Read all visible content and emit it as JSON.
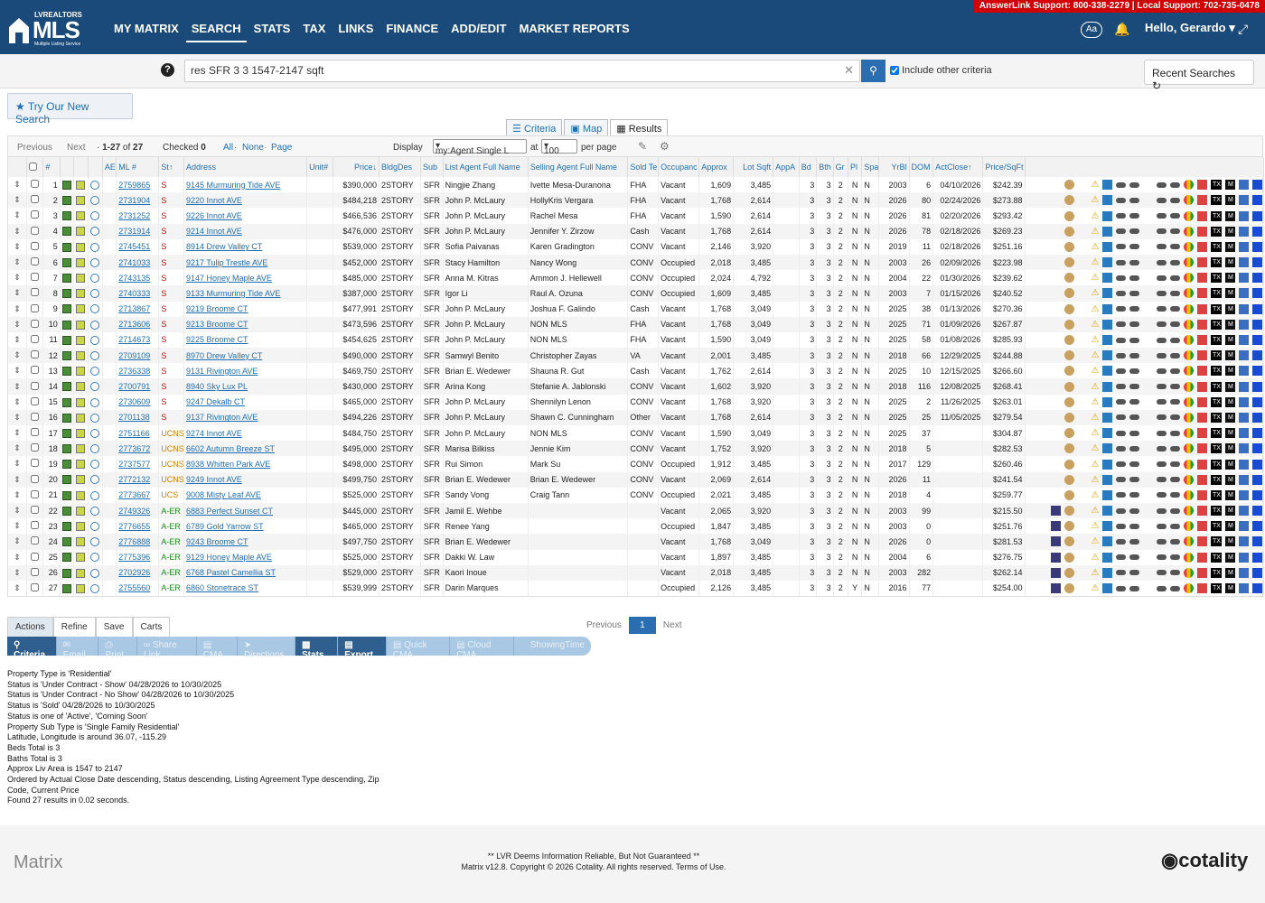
{
  "support": {
    "text": "AnswerLink Support: 800-338-2279 | Local Support: 702-735-0478"
  },
  "logo": {
    "top": "LVREALTORS",
    "main": "MLS",
    "sub": "Multiple Listing Service"
  },
  "nav": [
    "MY MATRIX",
    "SEARCH",
    "STATS",
    "TAX",
    "LINKS",
    "FINANCE",
    "ADD/EDIT",
    "MARKET REPORTS"
  ],
  "header": {
    "aa": "Aa",
    "hello": "Hello, Gerardo"
  },
  "search": {
    "value": "res SFR 3 3 1547-2147 sqft",
    "include": "Include other criteria",
    "recent": "Recent Searches"
  },
  "try_new": "Try Our New Search",
  "view_tabs": [
    "Criteria",
    "Map",
    "Results"
  ],
  "pagebar": {
    "previous": "Previous",
    "next": "Next",
    "range": "1-27",
    "of": "of",
    "total": "27",
    "checked_label": "Checked",
    "checked": "0",
    "all": "All",
    "none": "None",
    "page": "Page",
    "display": "Display",
    "display_value": "my:Agent Single L",
    "at": "at",
    "per_value": "100",
    "per_page": "per page"
  },
  "columns": [
    "",
    "#",
    "",
    "",
    "",
    "AE",
    "ML #",
    "St",
    "Address",
    "Unit#",
    "Price",
    "BldgDes",
    "Sub",
    "List Agent Full Name",
    "Selling Agent Full Name",
    "Sold Te",
    "Occupanc",
    "Approx",
    "Lot Sqft",
    "AppA",
    "Bd",
    "Bth",
    "Gr",
    "Pl",
    "Spa",
    "YrBl",
    "DOM",
    "ActClose",
    "Price/SqFt"
  ],
  "rows": [
    {
      "n": "1",
      "ml": "2759865",
      "st": "S",
      "addr": "9145 Murmuring Tide AVE",
      "price": "$390,000",
      "bldg": "2STORY",
      "sub": "SFR",
      "list": "Ningjie Zhang",
      "sell": "Ivette Mesa-Duranona",
      "terms": "FHA",
      "occ": "Vacant",
      "approx": "1,609",
      "lot": "3,485",
      "bd": "3",
      "bth": "3",
      "gr": "2",
      "pl": "N",
      "spa": "N",
      "yr": "2003",
      "dom": "6",
      "close": "04/10/2026",
      "ppsf": "$242.39"
    },
    {
      "n": "2",
      "ml": "2731904",
      "st": "S",
      "addr": "9220 Innot AVE",
      "price": "$484,218",
      "bldg": "2STORY",
      "sub": "SFR",
      "list": "John P. McLaury",
      "sell": "HollyKris Vergara",
      "terms": "FHA",
      "occ": "Vacant",
      "approx": "1,768",
      "lot": "2,614",
      "bd": "3",
      "bth": "3",
      "gr": "2",
      "pl": "N",
      "spa": "N",
      "yr": "2026",
      "dom": "80",
      "close": "02/24/2026",
      "ppsf": "$273.88"
    },
    {
      "n": "3",
      "ml": "2731252",
      "st": "S",
      "addr": "9226 Innot AVE",
      "price": "$466,536",
      "bldg": "2STORY",
      "sub": "SFR",
      "list": "John P. McLaury",
      "sell": "Rachel Mesa",
      "terms": "FHA",
      "occ": "Vacant",
      "approx": "1,590",
      "lot": "2,614",
      "bd": "3",
      "bth": "3",
      "gr": "2",
      "pl": "N",
      "spa": "N",
      "yr": "2026",
      "dom": "81",
      "close": "02/20/2026",
      "ppsf": "$293.42"
    },
    {
      "n": "4",
      "ml": "2731914",
      "st": "S",
      "addr": "9214 Innot AVE",
      "price": "$476,000",
      "bldg": "2STORY",
      "sub": "SFR",
      "list": "John P. McLaury",
      "sell": "Jennifer Y. Zirzow",
      "terms": "Cash",
      "occ": "Vacant",
      "approx": "1,768",
      "lot": "2,614",
      "bd": "3",
      "bth": "3",
      "gr": "2",
      "pl": "N",
      "spa": "N",
      "yr": "2026",
      "dom": "78",
      "close": "02/18/2026",
      "ppsf": "$269.23"
    },
    {
      "n": "5",
      "ml": "2745451",
      "st": "S",
      "addr": "8914 Drew Valley CT",
      "price": "$539,000",
      "bldg": "2STORY",
      "sub": "SFR",
      "list": "Sofia Paivanas",
      "sell": "Karen Gradington",
      "terms": "CONV",
      "occ": "Vacant",
      "approx": "2,146",
      "lot": "3,920",
      "bd": "3",
      "bth": "3",
      "gr": "2",
      "pl": "N",
      "spa": "N",
      "yr": "2019",
      "dom": "11",
      "close": "02/18/2026",
      "ppsf": "$251.16"
    },
    {
      "n": "6",
      "ml": "2741033",
      "st": "S",
      "addr": "9217 Tulip Trestle AVE",
      "price": "$452,000",
      "bldg": "2STORY",
      "sub": "SFR",
      "list": "Stacy Hamilton",
      "sell": "Nancy Wong",
      "terms": "CONV",
      "occ": "Occupied",
      "approx": "2,018",
      "lot": "3,485",
      "bd": "3",
      "bth": "3",
      "gr": "2",
      "pl": "N",
      "spa": "N",
      "yr": "2003",
      "dom": "26",
      "close": "02/09/2026",
      "ppsf": "$223.98"
    },
    {
      "n": "7",
      "ml": "2743135",
      "st": "S",
      "addr": "9147 Honey Maple AVE",
      "price": "$485,000",
      "bldg": "2STORY",
      "sub": "SFR",
      "list": "Anna M. Kitras",
      "sell": "Ammon J. Hellewell",
      "terms": "CONV",
      "occ": "Occupied",
      "approx": "2,024",
      "lot": "4,792",
      "bd": "3",
      "bth": "3",
      "gr": "2",
      "pl": "N",
      "spa": "N",
      "yr": "2004",
      "dom": "22",
      "close": "01/30/2026",
      "ppsf": "$239.62"
    },
    {
      "n": "8",
      "ml": "2740333",
      "st": "S",
      "addr": "9133 Murmuring Tide AVE",
      "price": "$387,000",
      "bldg": "2STORY",
      "sub": "SFR",
      "list": "Igor Li",
      "sell": "Raul A. Ozuna",
      "terms": "CONV",
      "occ": "Occupied",
      "approx": "1,609",
      "lot": "3,485",
      "bd": "3",
      "bth": "3",
      "gr": "2",
      "pl": "N",
      "spa": "N",
      "yr": "2003",
      "dom": "7",
      "close": "01/15/2026",
      "ppsf": "$240.52"
    },
    {
      "n": "9",
      "ml": "2713867",
      "st": "S",
      "addr": "9219 Broome CT",
      "price": "$477,991",
      "bldg": "2STORY",
      "sub": "SFR",
      "list": "John P. McLaury",
      "sell": "Joshua F. Galindo",
      "terms": "Cash",
      "occ": "Vacant",
      "approx": "1,768",
      "lot": "3,049",
      "bd": "3",
      "bth": "3",
      "gr": "2",
      "pl": "N",
      "spa": "N",
      "yr": "2025",
      "dom": "38",
      "close": "01/13/2026",
      "ppsf": "$270.36"
    },
    {
      "n": "10",
      "ml": "2713606",
      "st": "S",
      "addr": "9213 Broome CT",
      "price": "$473,596",
      "bldg": "2STORY",
      "sub": "SFR",
      "list": "John P. McLaury",
      "sell": "NON MLS",
      "terms": "FHA",
      "occ": "Vacant",
      "approx": "1,768",
      "lot": "3,049",
      "bd": "3",
      "bth": "3",
      "gr": "2",
      "pl": "N",
      "spa": "N",
      "yr": "2025",
      "dom": "71",
      "close": "01/09/2026",
      "ppsf": "$267.87"
    },
    {
      "n": "11",
      "ml": "2714673",
      "st": "S",
      "addr": "9225 Broome CT",
      "price": "$454,625",
      "bldg": "2STORY",
      "sub": "SFR",
      "list": "John P. McLaury",
      "sell": "NON MLS",
      "terms": "FHA",
      "occ": "Vacant",
      "approx": "1,590",
      "lot": "3,049",
      "bd": "3",
      "bth": "3",
      "gr": "2",
      "pl": "N",
      "spa": "N",
      "yr": "2025",
      "dom": "58",
      "close": "01/08/2026",
      "ppsf": "$285.93"
    },
    {
      "n": "12",
      "ml": "2709109",
      "st": "S",
      "addr": "8970 Drew Valley CT",
      "price": "$490,000",
      "bldg": "2STORY",
      "sub": "SFR",
      "list": "Samwyl Benito",
      "sell": "Christopher Zayas",
      "terms": "VA",
      "occ": "Vacant",
      "approx": "2,001",
      "lot": "3,485",
      "bd": "3",
      "bth": "3",
      "gr": "2",
      "pl": "N",
      "spa": "N",
      "yr": "2018",
      "dom": "66",
      "close": "12/29/2025",
      "ppsf": "$244.88"
    },
    {
      "n": "13",
      "ml": "2736338",
      "st": "S",
      "addr": "9131 Rivington AVE",
      "price": "$469,750",
      "bldg": "2STORY",
      "sub": "SFR",
      "list": "Brian E. Wedewer",
      "sell": "Shauna R. Gut",
      "terms": "Cash",
      "occ": "Vacant",
      "approx": "1,762",
      "lot": "2,614",
      "bd": "3",
      "bth": "3",
      "gr": "2",
      "pl": "N",
      "spa": "N",
      "yr": "2025",
      "dom": "10",
      "close": "12/15/2025",
      "ppsf": "$266.60"
    },
    {
      "n": "14",
      "ml": "2700791",
      "st": "S",
      "addr": "8940 Sky Lux PL",
      "price": "$430,000",
      "bldg": "2STORY",
      "sub": "SFR",
      "list": "Arina Kong",
      "sell": "Stefanie A. Jablonski",
      "terms": "CONV",
      "occ": "Vacant",
      "approx": "1,602",
      "lot": "3,920",
      "bd": "3",
      "bth": "3",
      "gr": "2",
      "pl": "N",
      "spa": "N",
      "yr": "2018",
      "dom": "116",
      "close": "12/08/2025",
      "ppsf": "$268.41"
    },
    {
      "n": "15",
      "ml": "2730609",
      "st": "S",
      "addr": "9247 Dekalb CT",
      "price": "$465,000",
      "bldg": "2STORY",
      "sub": "SFR",
      "list": "John P. McLaury",
      "sell": "Shennilyn Lenon",
      "terms": "CONV",
      "occ": "Vacant",
      "approx": "1,768",
      "lot": "3,920",
      "bd": "3",
      "bth": "3",
      "gr": "2",
      "pl": "N",
      "spa": "N",
      "yr": "2025",
      "dom": "2",
      "close": "11/26/2025",
      "ppsf": "$263.01"
    },
    {
      "n": "16",
      "ml": "2701138",
      "st": "S",
      "addr": "9137 Rivington AVE",
      "price": "$494,226",
      "bldg": "2STORY",
      "sub": "SFR",
      "list": "John P. McLaury",
      "sell": "Shawn C. Cunningham",
      "terms": "Other",
      "occ": "Vacant",
      "approx": "1,768",
      "lot": "2,614",
      "bd": "3",
      "bth": "3",
      "gr": "2",
      "pl": "N",
      "spa": "N",
      "yr": "2025",
      "dom": "25",
      "close": "11/05/2025",
      "ppsf": "$279.54"
    },
    {
      "n": "17",
      "ml": "2751166",
      "st": "UCNS",
      "addr": "9274 Innot AVE",
      "price": "$484,750",
      "bldg": "2STORY",
      "sub": "SFR",
      "list": "John P. McLaury",
      "sell": "NON MLS",
      "terms": "CONV",
      "occ": "Vacant",
      "approx": "1,590",
      "lot": "3,049",
      "bd": "3",
      "bth": "3",
      "gr": "2",
      "pl": "N",
      "spa": "N",
      "yr": "2025",
      "dom": "37",
      "close": "",
      "ppsf": "$304.87"
    },
    {
      "n": "18",
      "ml": "2773672",
      "st": "UCNS",
      "addr": "6602 Autumn Breeze ST",
      "price": "$495,000",
      "bldg": "2STORY",
      "sub": "SFR",
      "list": "Marisa Bilkiss",
      "sell": "Jennie Kim",
      "terms": "CONV",
      "occ": "Vacant",
      "approx": "1,752",
      "lot": "3,920",
      "bd": "3",
      "bth": "3",
      "gr": "2",
      "pl": "N",
      "spa": "N",
      "yr": "2018",
      "dom": "5",
      "close": "",
      "ppsf": "$282.53"
    },
    {
      "n": "19",
      "ml": "2737577",
      "st": "UCNS",
      "addr": "8938 Whitten Park AVE",
      "price": "$498,000",
      "bldg": "2STORY",
      "sub": "SFR",
      "list": "Rui Simon",
      "sell": "Mark Su",
      "terms": "CONV",
      "occ": "Occupied",
      "approx": "1,912",
      "lot": "3,485",
      "bd": "3",
      "bth": "3",
      "gr": "2",
      "pl": "N",
      "spa": "N",
      "yr": "2017",
      "dom": "129",
      "close": "",
      "ppsf": "$260.46"
    },
    {
      "n": "20",
      "ml": "2772132",
      "st": "UCNS",
      "addr": "9249 Innot AVE",
      "price": "$499,750",
      "bldg": "2STORY",
      "sub": "SFR",
      "list": "Brian E. Wedewer",
      "sell": "Brian E. Wedewer",
      "terms": "CONV",
      "occ": "Vacant",
      "approx": "2,069",
      "lot": "2,614",
      "bd": "3",
      "bth": "3",
      "gr": "2",
      "pl": "N",
      "spa": "N",
      "yr": "2026",
      "dom": "11",
      "close": "",
      "ppsf": "$241.54"
    },
    {
      "n": "21",
      "ml": "2773667",
      "st": "UCS",
      "addr": "9008 Misty Leaf AVE",
      "price": "$525,000",
      "bldg": "2STORY",
      "sub": "SFR",
      "list": "Sandy Vong",
      "sell": "Craig Tann",
      "terms": "CONV",
      "occ": "Occupied",
      "approx": "2,021",
      "lot": "3,485",
      "bd": "3",
      "bth": "3",
      "gr": "2",
      "pl": "N",
      "spa": "N",
      "yr": "2018",
      "dom": "4",
      "close": "",
      "ppsf": "$259.77"
    },
    {
      "n": "22",
      "ml": "2749326",
      "st": "A-ER",
      "addr": "6883 Perfect Sunset CT",
      "price": "$445,000",
      "bldg": "2STORY",
      "sub": "SFR",
      "list": "Jamil E. Wehbe",
      "sell": "",
      "terms": "",
      "occ": "Vacant",
      "approx": "2,065",
      "lot": "3,920",
      "bd": "3",
      "bth": "3",
      "gr": "2",
      "pl": "N",
      "spa": "N",
      "yr": "2003",
      "dom": "99",
      "close": "",
      "ppsf": "$215.50"
    },
    {
      "n": "23",
      "ml": "2776655",
      "st": "A-ER",
      "addr": "6789 Gold Yarrow ST",
      "price": "$465,000",
      "bldg": "2STORY",
      "sub": "SFR",
      "list": "Renee Yang",
      "sell": "",
      "terms": "",
      "occ": "Occupied",
      "approx": "1,847",
      "lot": "3,485",
      "bd": "3",
      "bth": "3",
      "gr": "2",
      "pl": "N",
      "spa": "N",
      "yr": "2003",
      "dom": "0",
      "close": "",
      "ppsf": "$251.76"
    },
    {
      "n": "24",
      "ml": "2776888",
      "st": "A-ER",
      "addr": "9243 Broome CT",
      "price": "$497,750",
      "bldg": "2STORY",
      "sub": "SFR",
      "list": "Brian E. Wedewer",
      "sell": "",
      "terms": "",
      "occ": "Vacant",
      "approx": "1,768",
      "lot": "3,049",
      "bd": "3",
      "bth": "3",
      "gr": "2",
      "pl": "N",
      "spa": "N",
      "yr": "2026",
      "dom": "0",
      "close": "",
      "ppsf": "$281.53"
    },
    {
      "n": "25",
      "ml": "2775396",
      "st": "A-ER",
      "addr": "9129 Honey Maple AVE",
      "price": "$525,000",
      "bldg": "2STORY",
      "sub": "SFR",
      "list": "Dakki W. Law",
      "sell": "",
      "terms": "",
      "occ": "Vacant",
      "approx": "1,897",
      "lot": "3,485",
      "bd": "3",
      "bth": "3",
      "gr": "2",
      "pl": "N",
      "spa": "N",
      "yr": "2004",
      "dom": "6",
      "close": "",
      "ppsf": "$276.75"
    },
    {
      "n": "26",
      "ml": "2702926",
      "st": "A-ER",
      "addr": "6768 Pastel Camellia ST",
      "price": "$529,000",
      "bldg": "2STORY",
      "sub": "SFR",
      "list": "Kaori Inoue",
      "sell": "",
      "terms": "",
      "occ": "Vacant",
      "approx": "2,018",
      "lot": "3,485",
      "bd": "3",
      "bth": "3",
      "gr": "2",
      "pl": "N",
      "spa": "N",
      "yr": "2003",
      "dom": "282",
      "close": "",
      "ppsf": "$262.14"
    },
    {
      "n": "27",
      "ml": "2755560",
      "st": "A-ER",
      "addr": "6860 Stonetrace ST",
      "price": "$539,999",
      "bldg": "2STORY",
      "sub": "SFR",
      "list": "Darin Marques",
      "sell": "",
      "terms": "",
      "occ": "Occupied",
      "approx": "2,126",
      "lot": "3,485",
      "bd": "3",
      "bth": "3",
      "gr": "2",
      "pl": "Y",
      "spa": "N",
      "yr": "2016",
      "dom": "77",
      "close": "",
      "ppsf": "$254.00"
    }
  ],
  "action_tabs": [
    "Actions",
    "Refine",
    "Save",
    "Carts"
  ],
  "action_buttons": [
    "Criteria",
    "Email",
    "Print",
    "Share Link",
    "CMA",
    "Directions",
    "Stats",
    "Export",
    "Quick CMA",
    "Cloud CMA",
    "ShowingTime"
  ],
  "pager": {
    "previous": "Previous",
    "page": "1",
    "next": "Next"
  },
  "criteria_lines": [
    "Property Type is 'Residential'",
    "Status is 'Under Contract - Show' 04/28/2026 to 10/30/2025",
    "Status is 'Under Contract - No Show' 04/28/2026 to 10/30/2025",
    "Status is 'Sold' 04/28/2026 to 10/30/2025",
    "Status is one of 'Active', 'Coming Soon'",
    "Property Sub Type is 'Single Family Residential'",
    "Latitude, Longitude is around 36.07, -115.29",
    "Beds Total is 3",
    "Baths Total is 3",
    "Approx Liv Area is 1547 to 2147",
    "Ordered by Actual Close Date descending, Status descending, Listing Agreement Type descending, Zip Code, Current Price",
    "Found 27 results in 0.02 seconds."
  ],
  "footer": {
    "brand": "Matrix",
    "line1": "** LVR Deems Information Reliable, But Not Guaranteed **",
    "line2": "Matrix v12.8. Copyright © 2026 Cotality. All rights reserved. Terms of Use.",
    "company": "cotality"
  }
}
